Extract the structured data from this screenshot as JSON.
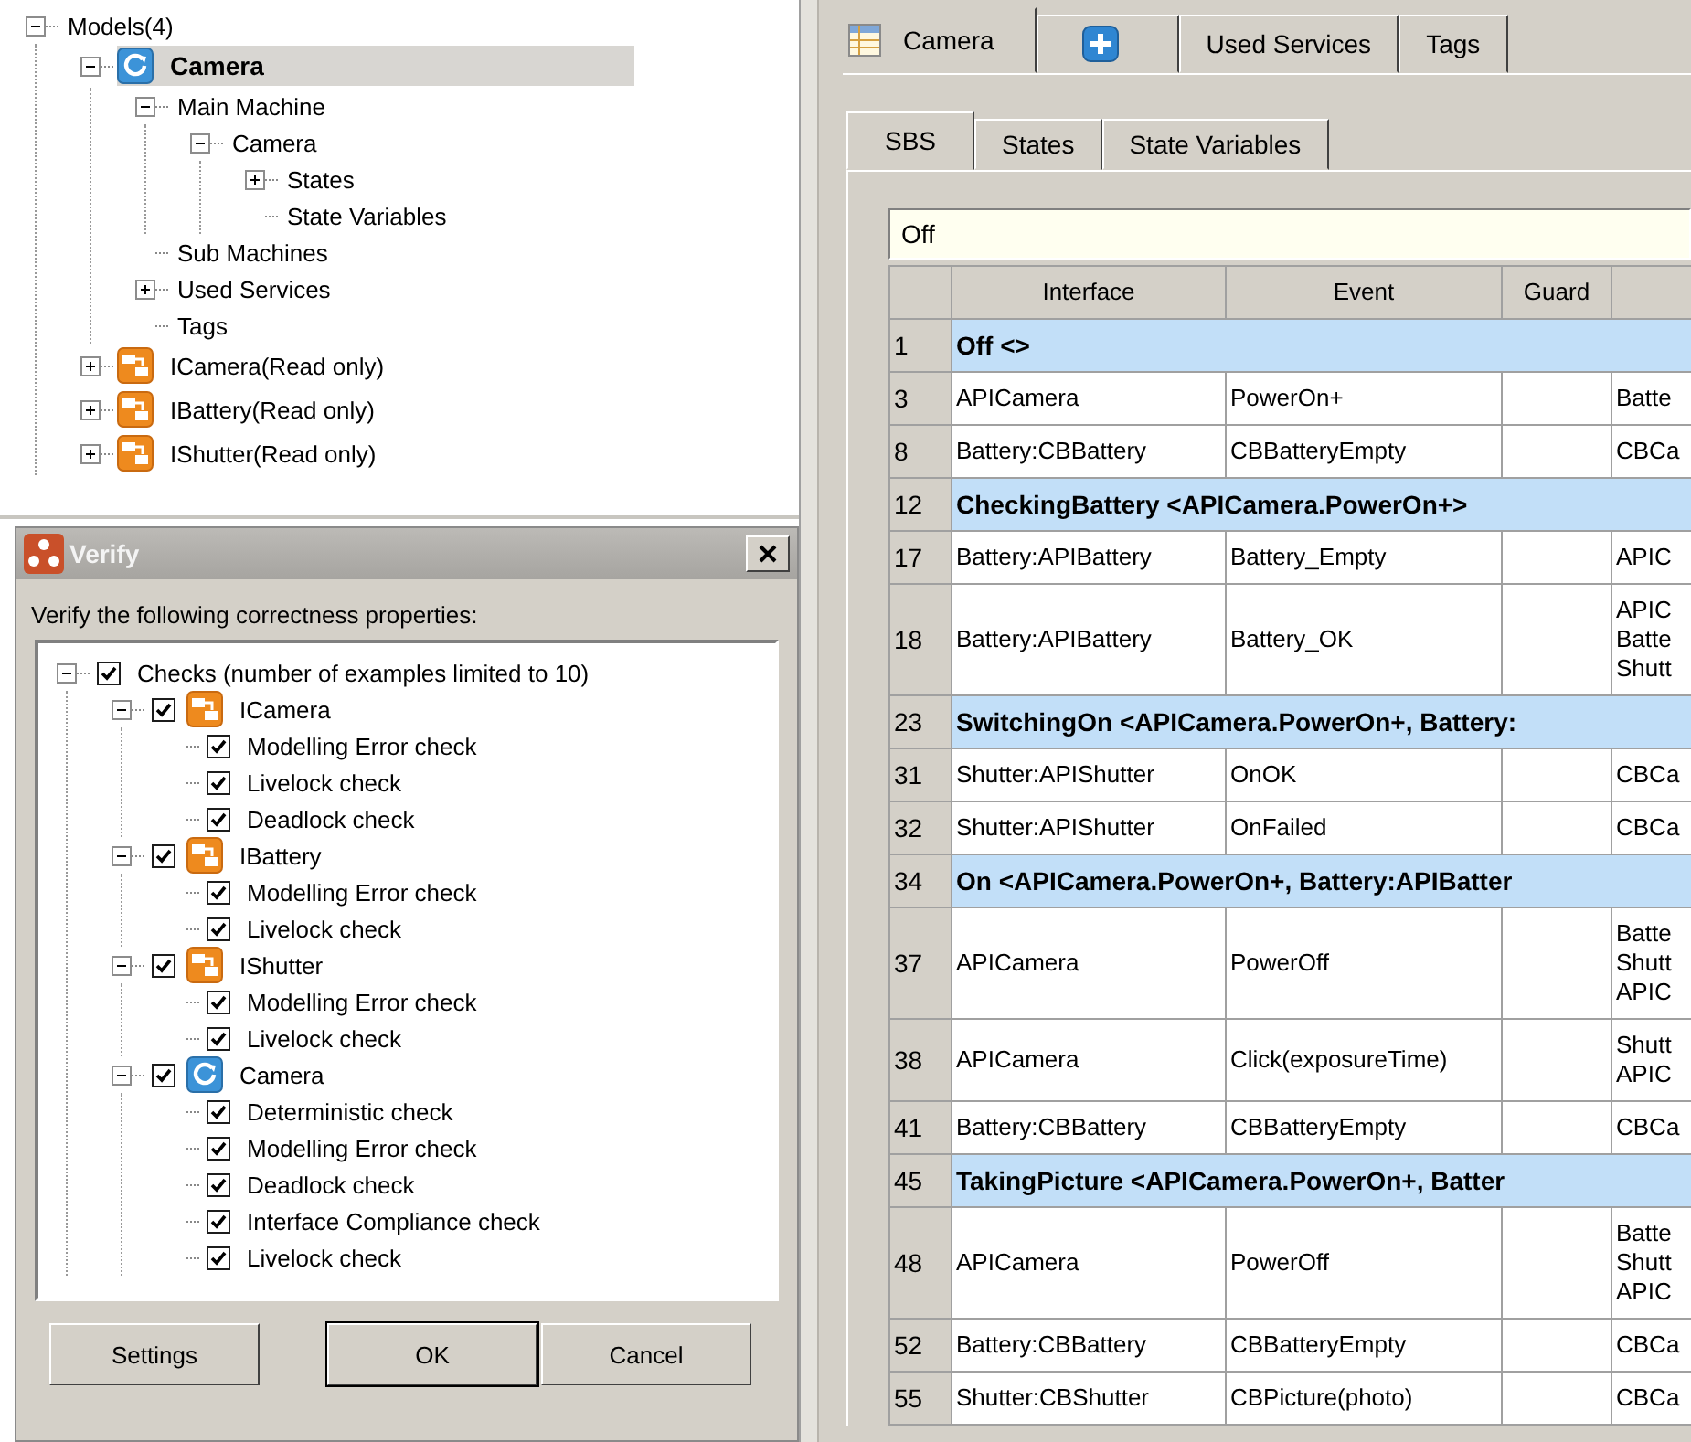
{
  "model_tree": [
    {
      "label": "Models(4)",
      "kind": "plain",
      "expanded": true,
      "selected": false,
      "children": [
        {
          "label": "Camera",
          "kind": "machine",
          "expanded": true,
          "selected": true,
          "children": [
            {
              "label": "Main Machine",
              "kind": "plain",
              "expanded": true,
              "selected": false,
              "children": [
                {
                  "label": "Camera",
                  "kind": "plain",
                  "expanded": true,
                  "selected": false,
                  "children": [
                    {
                      "label": "States",
                      "kind": "plain",
                      "expanded": false,
                      "selected": false
                    },
                    {
                      "label": "State Variables",
                      "kind": "plain",
                      "selected": false
                    }
                  ]
                }
              ]
            },
            {
              "label": "Sub Machines",
              "kind": "plain",
              "selected": false
            },
            {
              "label": "Used Services",
              "kind": "plain",
              "expanded": false,
              "selected": false
            },
            {
              "label": "Tags",
              "kind": "plain",
              "selected": false
            }
          ]
        },
        {
          "label": "ICamera(Read only)",
          "kind": "interface",
          "expanded": false,
          "selected": false
        },
        {
          "label": "IBattery(Read only)",
          "kind": "interface",
          "expanded": false,
          "selected": false
        },
        {
          "label": "IShutter(Read only)",
          "kind": "interface",
          "expanded": false,
          "selected": false
        }
      ]
    }
  ],
  "verify_dialog": {
    "title": "Verify",
    "prompt": "Verify the following correctness properties:",
    "checks": [
      {
        "label": "Checks (number of examples limited to 10)",
        "checked": true,
        "expanded": true,
        "children": [
          {
            "label": "ICamera",
            "kind": "interface",
            "checked": true,
            "expanded": true,
            "children": [
              {
                "label": "Modelling Error check",
                "checked": true
              },
              {
                "label": "Livelock check",
                "checked": true
              },
              {
                "label": "Deadlock check",
                "checked": true
              }
            ]
          },
          {
            "label": "IBattery",
            "kind": "interface",
            "checked": true,
            "expanded": true,
            "children": [
              {
                "label": "Modelling Error check",
                "checked": true
              },
              {
                "label": "Livelock check",
                "checked": true
              }
            ]
          },
          {
            "label": "IShutter",
            "kind": "interface",
            "checked": true,
            "expanded": true,
            "children": [
              {
                "label": "Modelling Error check",
                "checked": true
              },
              {
                "label": "Livelock check",
                "checked": true
              }
            ]
          },
          {
            "label": "Camera",
            "kind": "machine",
            "checked": true,
            "expanded": true,
            "children": [
              {
                "label": "Deterministic check",
                "checked": true
              },
              {
                "label": "Modelling Error check",
                "checked": true
              },
              {
                "label": "Deadlock check",
                "checked": true
              },
              {
                "label": "Interface Compliance check",
                "checked": true
              },
              {
                "label": "Livelock check",
                "checked": true
              }
            ]
          }
        ]
      }
    ],
    "buttons": [
      {
        "label": "Settings",
        "default": false
      },
      {
        "label": "OK",
        "default": true
      },
      {
        "label": "Cancel",
        "default": false
      }
    ]
  },
  "tabs": [
    {
      "label": "Camera",
      "kind": "table",
      "selected": true
    },
    {
      "kind": "add",
      "selected": false
    },
    {
      "label": "Used Services",
      "kind": "plain",
      "selected": false
    },
    {
      "label": "Tags",
      "kind": "plain",
      "selected": false
    }
  ],
  "sub_tabs": [
    {
      "label": "SBS",
      "selected": true
    },
    {
      "label": "States",
      "selected": false
    },
    {
      "label": "State Variables",
      "selected": false
    }
  ],
  "filter": {
    "value": "Off"
  },
  "table": {
    "columns": [
      "Interface",
      "Event",
      "Guard"
    ],
    "rows": [
      {
        "kind": "group",
        "number": "1",
        "text": "Off <>"
      },
      {
        "kind": "transition",
        "number": "3",
        "interface": "APICamera",
        "event": "PowerOn+",
        "column_5": [
          "Batte"
        ]
      },
      {
        "kind": "transition",
        "number": "8",
        "interface": "Battery:CBBattery",
        "event": "CBBatteryEmpty",
        "column_5": [
          "CBCa"
        ]
      },
      {
        "kind": "group",
        "number": "12",
        "text": "CheckingBattery <APICamera.PowerOn+>"
      },
      {
        "kind": "transition",
        "number": "17",
        "interface": "Battery:APIBattery",
        "event": "Battery_Empty",
        "column_5": [
          "APIC"
        ]
      },
      {
        "kind": "transition",
        "number": "18",
        "interface": "Battery:APIBattery",
        "event": "Battery_OK",
        "column_5": [
          "APIC",
          "Batte",
          "Shutt"
        ]
      },
      {
        "kind": "group",
        "number": "23",
        "text": "SwitchingOn <APICamera.PowerOn+, Battery:"
      },
      {
        "kind": "transition",
        "number": "31",
        "interface": "Shutter:APIShutter",
        "event": "OnOK",
        "column_5": [
          "CBCa"
        ]
      },
      {
        "kind": "transition",
        "number": "32",
        "interface": "Shutter:APIShutter",
        "event": "OnFailed",
        "column_5": [
          "CBCa"
        ]
      },
      {
        "kind": "group",
        "number": "34",
        "text": "On <APICamera.PowerOn+, Battery:APIBatter"
      },
      {
        "kind": "transition",
        "number": "37",
        "interface": "APICamera",
        "event": "PowerOff",
        "column_5": [
          "Batte",
          "Shutt",
          "APIC"
        ]
      },
      {
        "kind": "transition",
        "number": "38",
        "interface": "APICamera",
        "event": "Click(exposureTime)",
        "column_5": [
          "Shutt",
          "APIC"
        ]
      },
      {
        "kind": "transition",
        "number": "41",
        "interface": "Battery:CBBattery",
        "event": "CBBatteryEmpty",
        "column_5": [
          "CBCa"
        ]
      },
      {
        "kind": "group",
        "number": "45",
        "text": "TakingPicture <APICamera.PowerOn+, Batter"
      },
      {
        "kind": "transition",
        "number": "48",
        "interface": "APICamera",
        "event": "PowerOff",
        "column_5": [
          "Batte",
          "Shutt",
          "APIC"
        ]
      },
      {
        "kind": "transition",
        "number": "52",
        "interface": "Battery:CBBattery",
        "event": "CBBatteryEmpty",
        "column_5": [
          "CBCa"
        ]
      },
      {
        "kind": "transition",
        "number": "55",
        "interface": "Shutter:CBShutter",
        "event": "CBPicture(photo)",
        "column_5": [
          "CBCa"
        ]
      }
    ]
  }
}
